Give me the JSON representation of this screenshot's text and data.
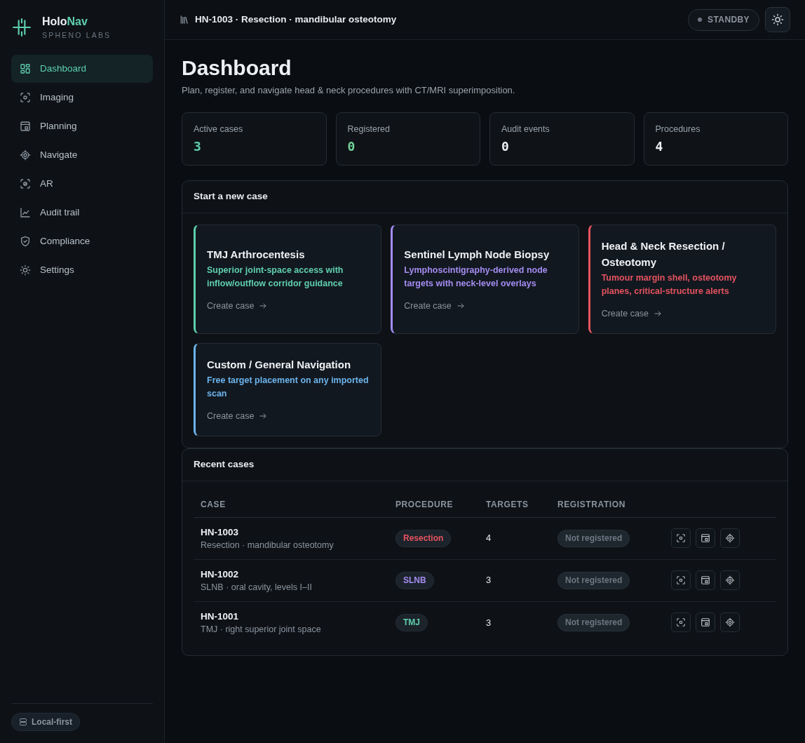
{
  "sidebar": {
    "brand": {
      "name": "Holo",
      "name_accent": "Nav",
      "subtitle": "SPHENO LABS"
    },
    "items": [
      {
        "label": "Dashboard",
        "selected": true
      },
      {
        "label": "Imaging",
        "selected": false
      },
      {
        "label": "Planning",
        "selected": false
      },
      {
        "label": "Navigate",
        "selected": false
      },
      {
        "label": "AR",
        "selected": false
      },
      {
        "label": "Audit trail",
        "selected": false
      },
      {
        "label": "Compliance",
        "selected": false
      },
      {
        "label": "Settings",
        "selected": false
      }
    ],
    "footer_badge": "Local-first"
  },
  "top_bar": {
    "case_title": "HN-1003 · Resection · mandibular osteotomy",
    "status": "STANDBY"
  },
  "page": {
    "title": "Dashboard",
    "subtitle": "Plan, register, and navigate head & neck procedures with CT/MRI superimposition."
  },
  "stats": [
    {
      "label": "Active cases",
      "value": "3",
      "color": "#5fcfae"
    },
    {
      "label": "Registered",
      "value": "0",
      "color": "#72d49a"
    },
    {
      "label": "Audit events",
      "value": "0",
      "color": "#eef1f4"
    },
    {
      "label": "Procedures",
      "value": "4",
      "color": "#eef1f4"
    }
  ],
  "new_case": {
    "title": "Start a new case",
    "procedures": [
      {
        "title": "TMJ Arthrocentesis",
        "description": "Superior joint-space access with inflow/outflow corridor guidance",
        "action": "Create case",
        "color": "#5fcfae"
      },
      {
        "title": "Sentinel Lymph Node Biopsy",
        "description": "Lymphoscintigraphy-derived node targets with neck-level overlays",
        "action": "Create case",
        "color": "#a48cf0"
      },
      {
        "title": "Head & Neck Resection / Osteotomy",
        "description": "Tumour margin shell, osteotomy planes, critical-structure alerts",
        "action": "Create case",
        "color": "#e5535f"
      },
      {
        "title": "Custom / General Navigation",
        "description": "Free target placement on any imported scan",
        "action": "Create case",
        "color": "#6cb4ec"
      }
    ]
  },
  "recent_cases": {
    "title": "Recent cases",
    "columns": [
      "CASE",
      "PROCEDURE",
      "TARGETS",
      "REGISTRATION"
    ],
    "rows": [
      {
        "case_id": "HN-1003",
        "description": "Resection · mandibular osteotomy",
        "procedure": "Resection",
        "color": "#e5535f",
        "targets": "4",
        "registration": "Not registered"
      },
      {
        "case_id": "HN-1002",
        "description": "SLNB · oral cavity, levels I–II",
        "procedure": "SLNB",
        "color": "#a48cf0",
        "targets": "3",
        "registration": "Not registered"
      },
      {
        "case_id": "HN-1001",
        "description": "TMJ · right superior joint space",
        "procedure": "TMJ",
        "color": "#5fcfae",
        "targets": "3",
        "registration": "Not registered"
      }
    ]
  }
}
